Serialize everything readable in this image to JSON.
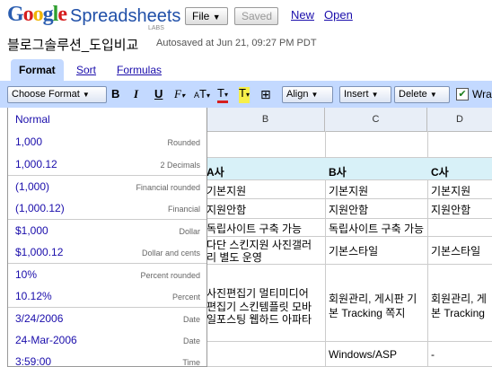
{
  "header": {
    "logo_text": "Google",
    "product": "Spreadsheets",
    "labs": "LABS",
    "file_label": "File",
    "saved_label": "Saved",
    "new_link": "New",
    "open_link": "Open",
    "doc_title": "블로그솔루션_도입비교",
    "autosave": "Autosaved at Jun 21, 09:27 PM PDT"
  },
  "tabs": [
    {
      "label": "Format",
      "active": true
    },
    {
      "label": "Sort",
      "active": false
    },
    {
      "label": "Formulas",
      "active": false
    }
  ],
  "toolbar": {
    "choose_format": "Choose Format",
    "bold": "B",
    "italic": "I",
    "underline": "U",
    "font_family": "F",
    "font_size": "T",
    "text_color": "T",
    "bg_color": "T",
    "align": "Align",
    "insert": "Insert",
    "delete": "Delete",
    "wrap": "Wra",
    "wrap_checked": true
  },
  "columns": [
    "B",
    "C",
    "D"
  ],
  "grid": {
    "rows": [
      {
        "b": "",
        "c": "",
        "d": ""
      },
      {
        "b": "A사",
        "c": "B사",
        "d": "C사",
        "header": true
      },
      {
        "b": "기본지원",
        "c": "기본지원",
        "d": "기본지원"
      },
      {
        "b": "지원안함",
        "c": "지원안함",
        "d": "지원안함"
      },
      {
        "b": "독립사이트 구축 가능",
        "c": "독립사이트 구축 가능",
        "d": ""
      },
      {
        "b_lines": [
          "다단 스킨지원 사진갤러",
          "리 별도 운영"
        ],
        "c": "기본스타일",
        "d": "기본스타일"
      },
      {
        "b_lines": [
          "사진편집기 멀티미디어",
          "편집기 스킨템플릿 모바",
          "일포스팅 웹하드 아파타"
        ],
        "c_lines": [
          "회원관리, 게시판 기",
          "본 Tracking 쪽지"
        ],
        "d_lines": [
          "회원관리, 게",
          "본 Tracking"
        ]
      },
      {
        "b": "",
        "c": "Windows/ASP",
        "d": "-"
      }
    ]
  },
  "format_menu": [
    {
      "label": "Normal",
      "hint": ""
    },
    {
      "label": "1,000",
      "hint": "Rounded"
    },
    {
      "label": "1,000.12",
      "hint": "2 Decimals"
    },
    {
      "label": "(1,000)",
      "hint": "Financial rounded"
    },
    {
      "label": "(1,000.12)",
      "hint": "Financial"
    },
    {
      "label": "$1,000",
      "hint": "Dollar"
    },
    {
      "label": "$1,000.12",
      "hint": "Dollar and cents"
    },
    {
      "label": "10%",
      "hint": "Percent rounded"
    },
    {
      "label": "10.12%",
      "hint": "Percent"
    },
    {
      "label": "3/24/2006",
      "hint": "Date"
    },
    {
      "label": "24-Mar-2006",
      "hint": "Date"
    },
    {
      "label": "3:59:00",
      "hint": "Time"
    }
  ],
  "colors": {
    "accent": "#c3d9ff",
    "link": "#1a0dab",
    "header_row": "#d8f1f8"
  }
}
